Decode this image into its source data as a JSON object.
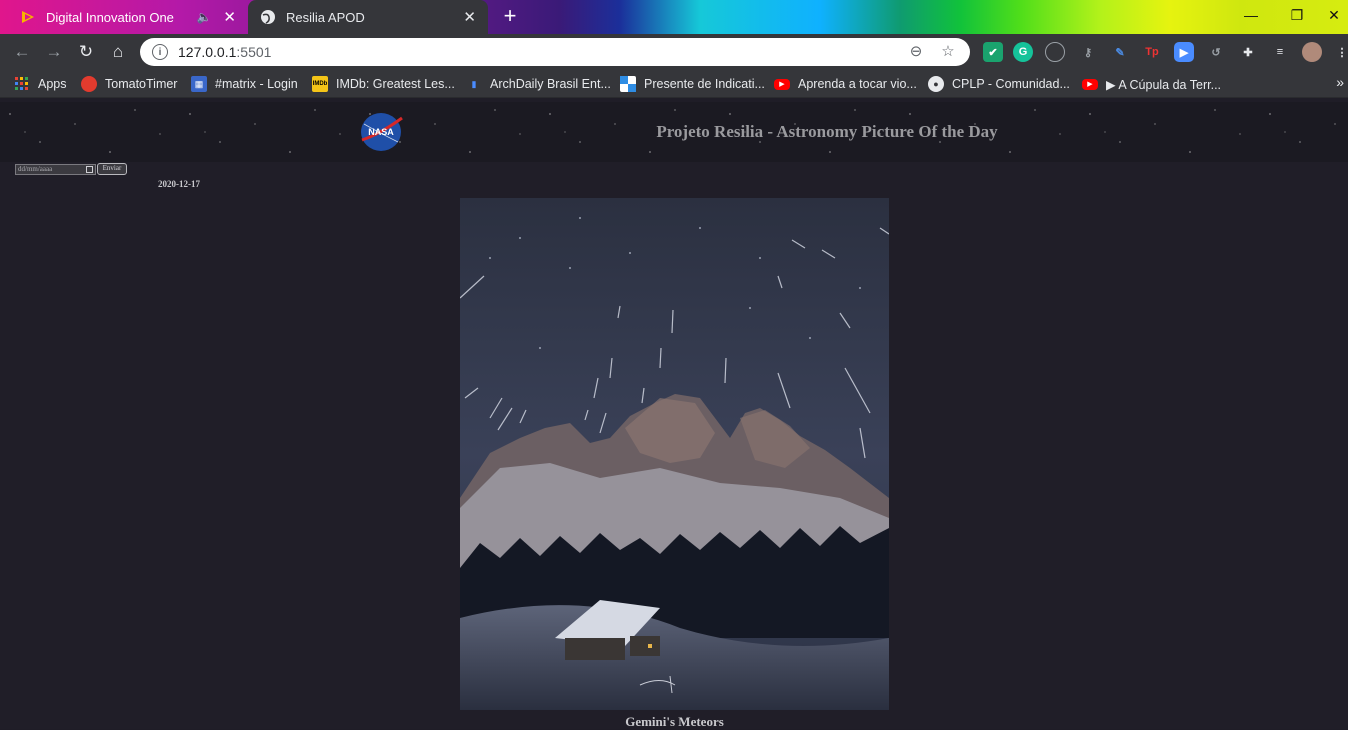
{
  "browser": {
    "tabs": [
      {
        "title": "Digital Innovation One",
        "active": false,
        "icon": "dio-icon"
      },
      {
        "title": "Resilia APOD",
        "active": true,
        "icon": "globe-icon"
      }
    ],
    "address": {
      "host": "127.0.0.1",
      "port": ":5501"
    },
    "bookmarks": [
      {
        "label": "Apps",
        "icon": "apps-grid-icon"
      },
      {
        "label": "TomatoTimer",
        "icon": "tomato-icon"
      },
      {
        "label": "#matrix - Login",
        "icon": "matrix-icon"
      },
      {
        "label": "IMDb: Greatest Les...",
        "icon": "imdb-icon"
      },
      {
        "label": "ArchDaily Brasil Ent...",
        "icon": "archdaily-icon"
      },
      {
        "label": "Presente de Indicati...",
        "icon": "gift-icon"
      },
      {
        "label": "Aprenda a tocar vio...",
        "icon": "youtube-icon"
      },
      {
        "label": "CPLP - Comunidad...",
        "icon": "globe-icon"
      },
      {
        "label": "▶ A Cúpula da Terr...",
        "icon": "youtube-icon"
      }
    ]
  },
  "page": {
    "site_title": "Projeto Resilia - Astronomy Picture Of the Day",
    "nasa_logo_text": "NASA",
    "date_placeholder": "dd/mm/aaaa",
    "submit_label": "Enviar",
    "apod_date": "2020-12-17",
    "apod_title": "Gemini's Meteors"
  },
  "colors": {
    "page_bg": "#201e28",
    "chrome_dark": "#35363a",
    "title_text": "#9a9a9e"
  }
}
